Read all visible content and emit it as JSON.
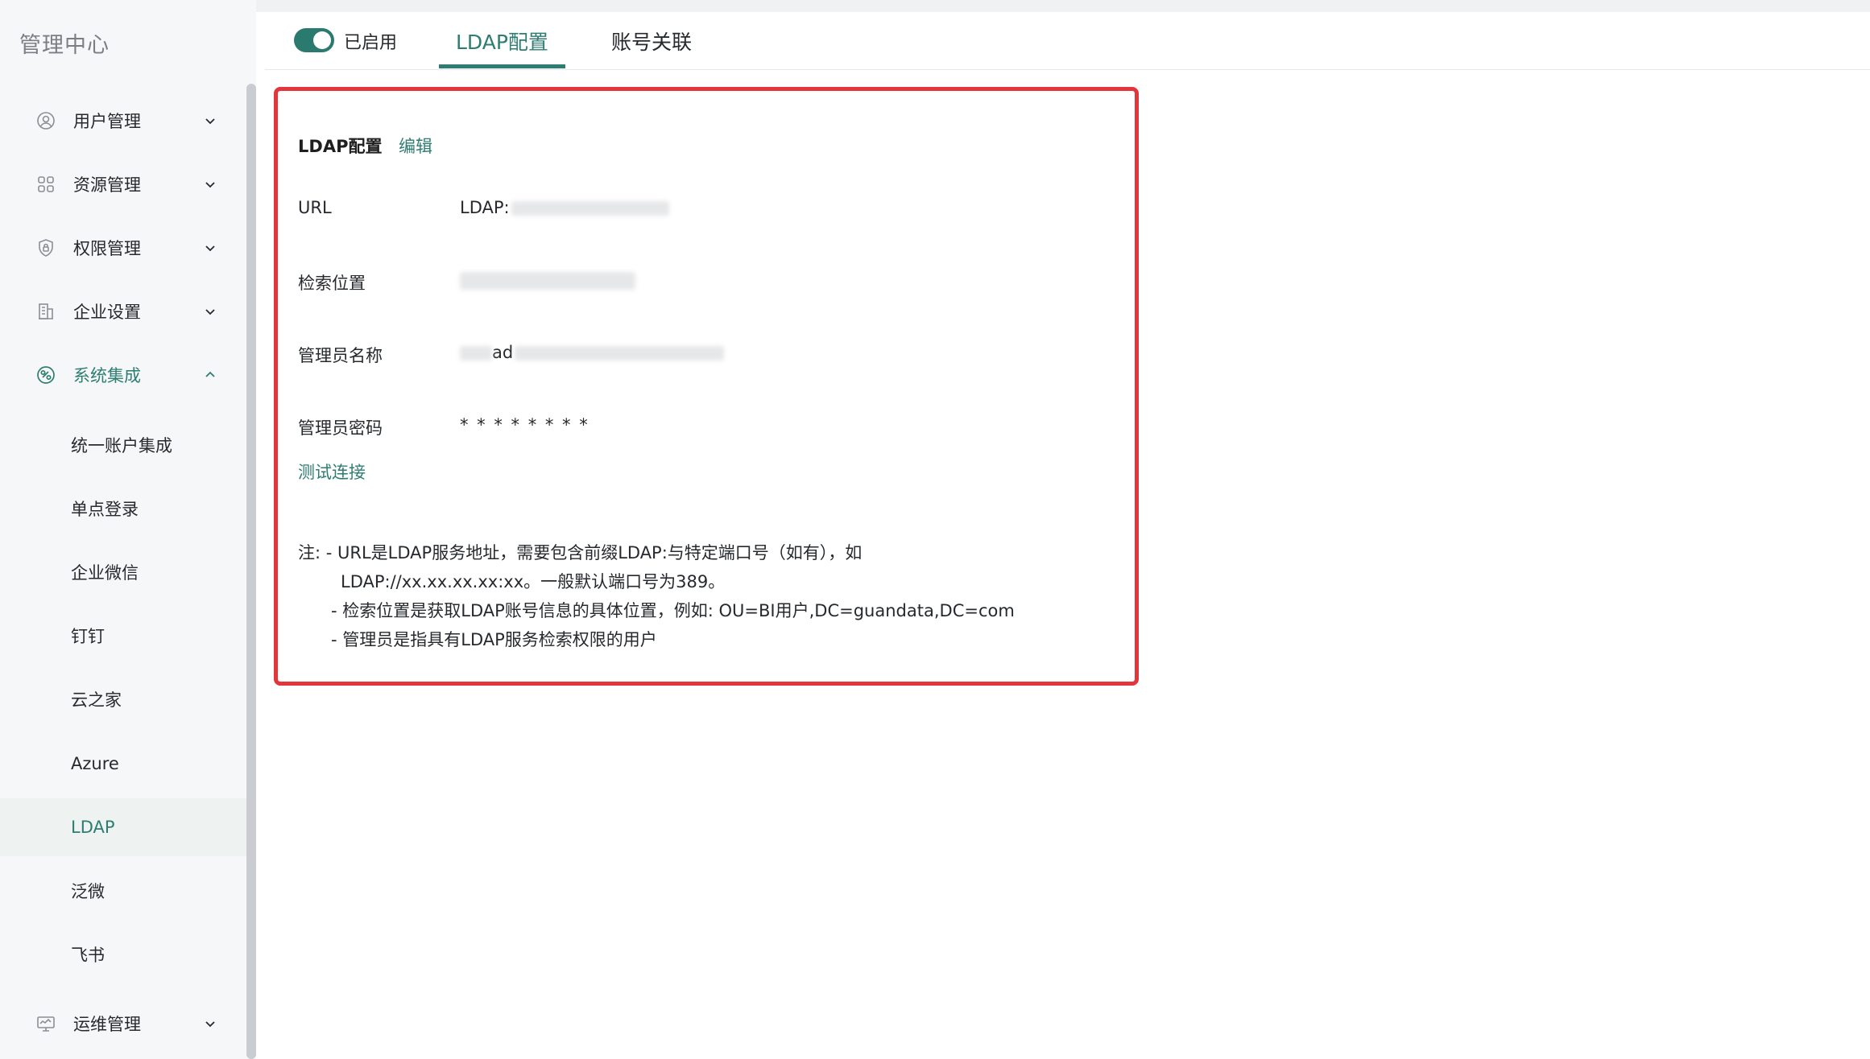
{
  "app_title": "管理中心",
  "sidebar": {
    "groups": [
      {
        "label": "用户管理",
        "icon": "user-icon",
        "expanded": false
      },
      {
        "label": "资源管理",
        "icon": "grid-icon",
        "expanded": false
      },
      {
        "label": "权限管理",
        "icon": "shield-icon",
        "expanded": false
      },
      {
        "label": "企业设置",
        "icon": "building-icon",
        "expanded": false
      },
      {
        "label": "系统集成",
        "icon": "integration-icon",
        "expanded": true
      },
      {
        "label": "运维管理",
        "icon": "monitor-icon",
        "expanded": false
      }
    ],
    "sub_items": [
      "统一账户集成",
      "单点登录",
      "企业微信",
      "钉钉",
      "云之家",
      "Azure",
      "LDAP",
      "泛微",
      "飞书"
    ],
    "selected_sub_item": "LDAP"
  },
  "tabs": {
    "toggle_label": "已启用",
    "toggle_on": true,
    "items": [
      "LDAP配置",
      "账号关联"
    ],
    "active": "LDAP配置"
  },
  "panel": {
    "title": "LDAP配置",
    "edit_label": "编辑",
    "fields": [
      {
        "label": "URL",
        "value": "LDAP:"
      },
      {
        "label": "检索位置",
        "value": ""
      },
      {
        "label": "管理员名称",
        "value": "ad"
      },
      {
        "label": "管理员密码",
        "value": "* * * * * * * *"
      }
    ],
    "test_link": "测试连接",
    "notes": [
      "注:  - URL是LDAP服务地址，需要包含前缀LDAP:与特定端口号（如有），如",
      "LDAP://xx.xx.xx.xx:xx。一般默认端口号为389。",
      "- 检索位置是获取LDAP账号信息的具体位置，例如: OU=BI用户,DC=guandata,DC=com",
      "- 管理员是指具有LDAP服务检索权限的用户"
    ]
  },
  "colors": {
    "accent": "#2e7d72",
    "highlight_border": "#e2363b",
    "sidebar_bg": "#f6f7f8"
  }
}
